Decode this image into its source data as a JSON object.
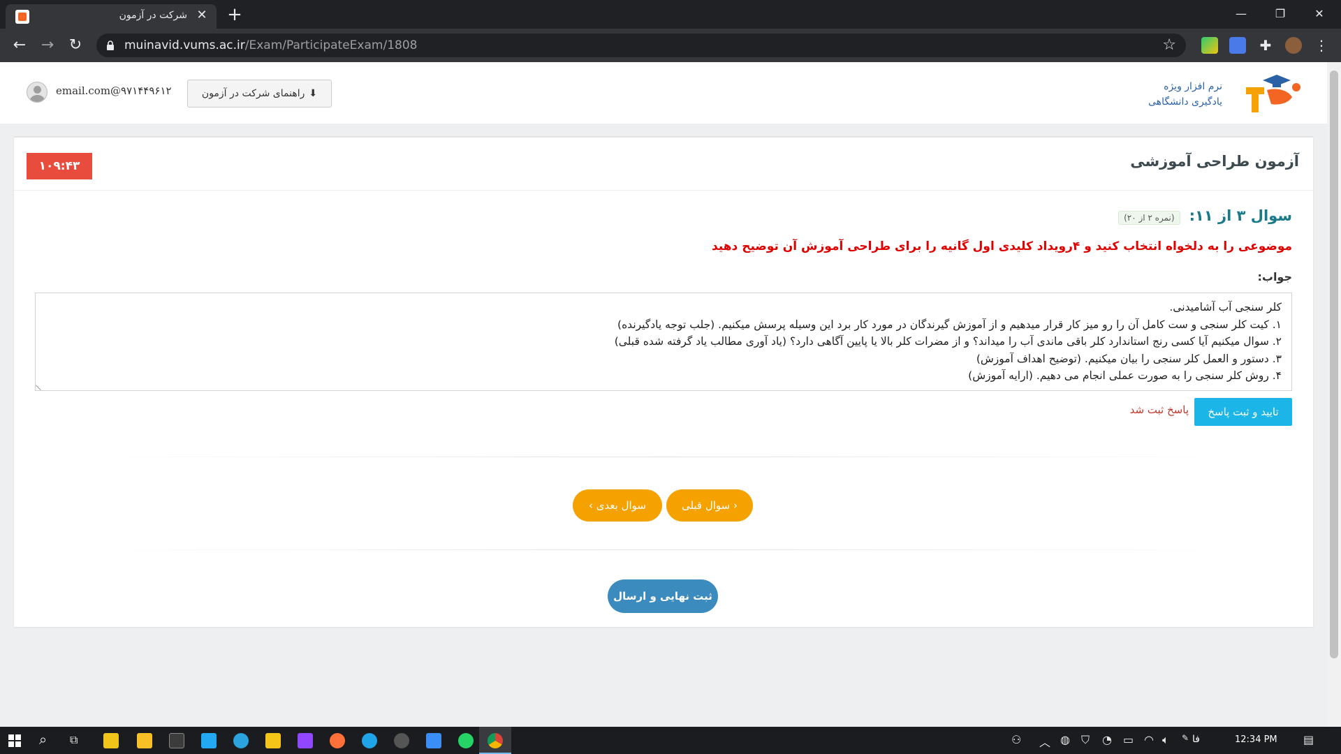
{
  "browser": {
    "tab_title": "شرکت در آزمون",
    "url_host": "muinavid.vums.ac.ir",
    "url_path": "/Exam/ParticipateExam/1808"
  },
  "header": {
    "user_email": "email.com@۹۷۱۴۴۹۶۱۲",
    "guide_button": "راهنمای شرکت در آزمون",
    "logo_line1": "نرم افزار ویژه",
    "logo_line2": "یادگیری دانشگاهی"
  },
  "exam": {
    "title": "آزمون طراحی آموزشی",
    "timer": "۱۰۹:۴۳",
    "question_title": "سوال ۳ از ۱۱:",
    "question_score": "(نمره ۲ از ۲۰)",
    "question_text": "موضوعی را به دلخواه انتخاب کنید و ۴رویداد کلیدی اول گانیه را برای طراحی آموزش آن توضیح دهید",
    "answer_label": "جواب:",
    "answer_lines": [
      "کلر سنجی آب آشامیدنی.",
      "۱. کیت کلر سنجی و ست کامل آن را رو میز کار قرار میدهیم و از آموزش گیرندگان در مورد کار برد این وسیله پرسش میکنیم. (جلب توجه یادگیرنده)",
      "۲. سوال میکنیم آیا کسی رنج استاندارد کلر باقی ماندی آب را میداند؟ و از مضرات کلر بالا یا پایین آگاهی دارد؟ (یاد آوری مطالب یاد گرفته شده قبلی)",
      "۳. دستور و العمل کلر سنجی را بیان میکنیم. (توضیح اهداف آموزش)",
      "۴. روش کلر سنجی را به صورت عملی انجام می دهیم. (ارایه آموزش)"
    ],
    "submit_button": "تایید و ثبت پاسخ",
    "saved_message": "پاسخ ثبت شد",
    "prev_button": "سوال قبلی",
    "next_button": "سوال بعدی",
    "final_button": "ثبت نهایی و ارسال"
  },
  "taskbar": {
    "lang": "فا",
    "time": "12:34 PM"
  },
  "colors": {
    "timer_bg": "#e74c3c",
    "question_title": "#1a7a8b",
    "question_text": "#e00000",
    "submit_bg": "#1bb5e8",
    "nav_bg": "#f5a100",
    "final_bg": "#3b8bbf"
  }
}
